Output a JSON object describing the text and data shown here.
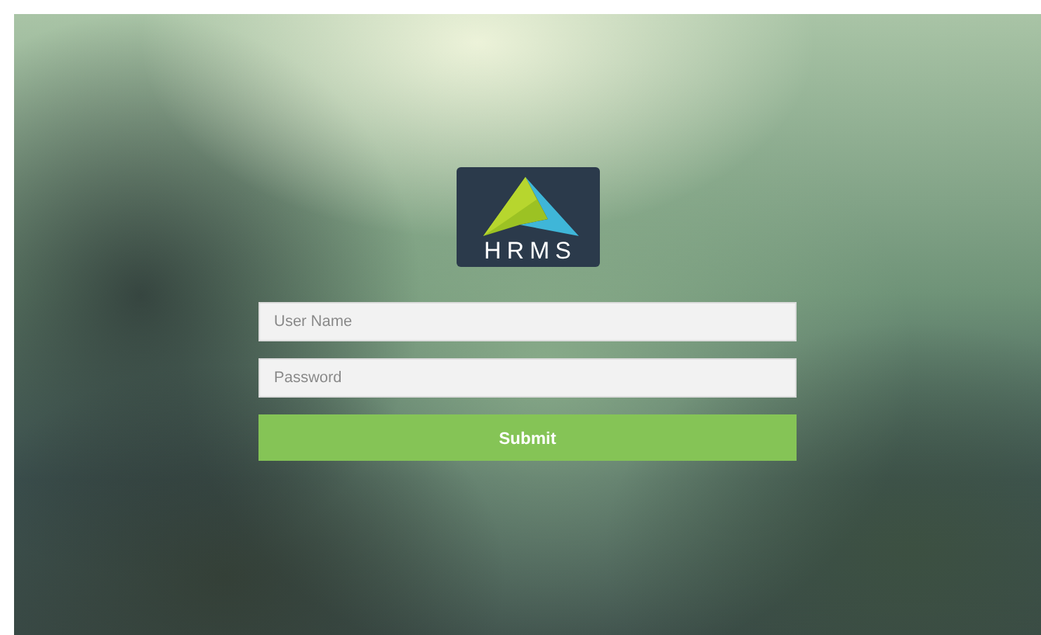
{
  "logo": {
    "text": "HRMS"
  },
  "form": {
    "fields": [
      {
        "placeholder": "User Name"
      },
      {
        "placeholder": "Password"
      }
    ],
    "submit": "Submit"
  }
}
